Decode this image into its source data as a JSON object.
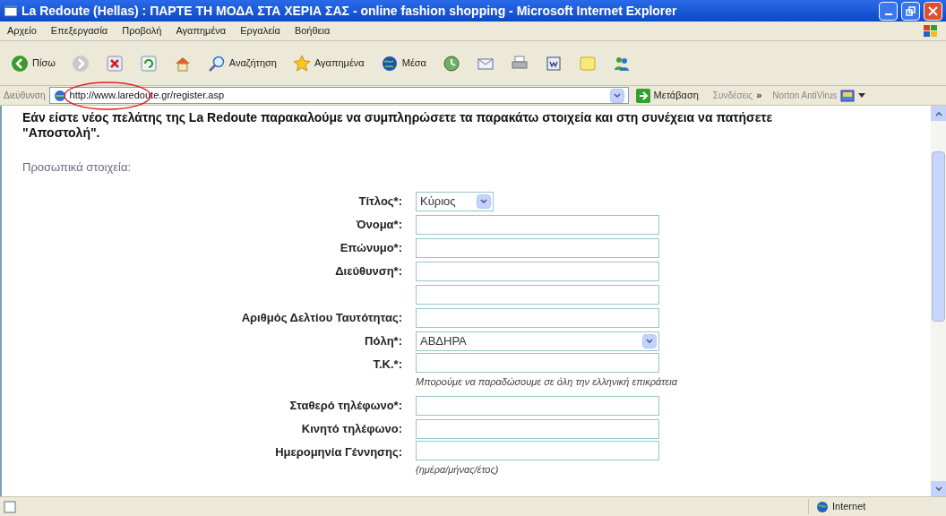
{
  "window": {
    "title": "La Redoute (Hellas) : ΠΑΡΤΕ ΤΗ ΜΟΔΑ ΣΤΑ ΧΕΡΙΑ ΣΑΣ - online fashion shopping - Microsoft Internet Explorer"
  },
  "menu": [
    "Αρχείο",
    "Επεξεργασία",
    "Προβολή",
    "Αγαπημένα",
    "Εργαλεία",
    "Βοήθεια"
  ],
  "toolbar": [
    {
      "kind": "back",
      "label": "Πίσω"
    },
    {
      "kind": "forward"
    },
    {
      "kind": "stop"
    },
    {
      "kind": "refresh"
    },
    {
      "kind": "home"
    },
    {
      "kind": "search",
      "label": "Αναζήτηση"
    },
    {
      "kind": "favorites",
      "label": "Αγαπημένα"
    },
    {
      "kind": "media",
      "label": "Μέσα"
    },
    {
      "kind": "history"
    },
    {
      "kind": "mail"
    },
    {
      "kind": "print"
    },
    {
      "kind": "word"
    },
    {
      "kind": "note"
    },
    {
      "kind": "messenger"
    }
  ],
  "address_bar": {
    "label": "Διεύθυνση",
    "url": "http://www.laredoute.gr/register.asp",
    "go": "Μετάβαση",
    "links": "Συνδέσεις",
    "more": "»",
    "norton": "Norton AntiVirus"
  },
  "page": {
    "intro": "Εάν είστε νέος πελάτης της La Redoute παρακαλούμε να συμπληρώσετε τα παρακάτω στοιχεία και στη συνέχεια να πατήσετε \"Αποστολή\".",
    "section": "Προσωπικά στοιχεία:",
    "fields": [
      {
        "kind": "select_small",
        "label": "Τίτλος*:",
        "value": "Κύριος"
      },
      {
        "kind": "text",
        "label": "Όνομα*:"
      },
      {
        "kind": "text",
        "label": "Επώνυμο*:"
      },
      {
        "kind": "text",
        "label": "Διεύθυνση*:"
      },
      {
        "kind": "text"
      },
      {
        "kind": "text",
        "label": "Αριθμός Δελτίου Ταυτότητας:"
      },
      {
        "kind": "select",
        "label": "Πόλη*:",
        "value": "ΑΒΔΗΡΑ"
      },
      {
        "kind": "text",
        "label": "Τ.Κ.*:",
        "hint": "Μπορούμε να παραδώσουμε σε όλη την ελληνική επικράτεια"
      },
      {
        "kind": "text",
        "label": "Σταθερό τηλέφωνο*:"
      },
      {
        "kind": "text",
        "label": "Κινητό τηλέφωνο:"
      },
      {
        "kind": "text",
        "label": "Ημερομηνία Γέννησης:",
        "hint": "(ημέρα/μήνας/έτος)"
      }
    ]
  },
  "status_bar": {
    "zone": "Internet"
  }
}
